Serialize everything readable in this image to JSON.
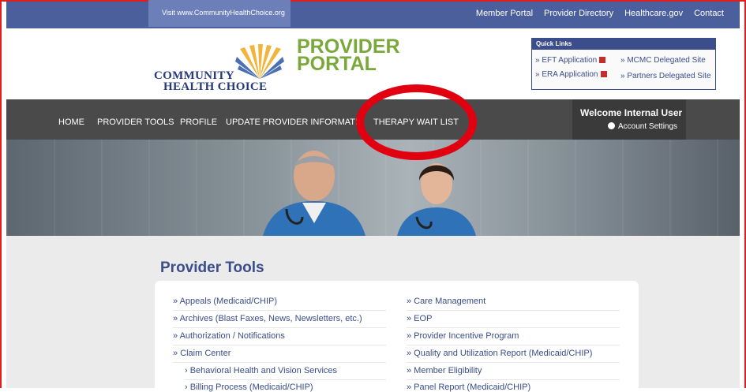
{
  "topbar": {
    "visit_link": "Visit www.CommunityHealthChoice.org",
    "nav": [
      "Member Portal",
      "Provider Directory",
      "Healthcare.gov",
      "Contact"
    ]
  },
  "logo": {
    "line1": "COMMUNITY",
    "line2": "HEALTH CHOICE"
  },
  "portal_title": {
    "line1": "PROVIDER",
    "line2": "PORTAL"
  },
  "quick_links": {
    "title": "Quick Links",
    "eft": "» EFT Application",
    "era": "» ERA Application",
    "mcmc": "» MCMC Delegated Site",
    "partners": "» Partners Delegated Site"
  },
  "main_nav": {
    "items": [
      "HOME",
      "PROVIDER TOOLS",
      "PROFILE",
      "UPDATE PROVIDER INFORMATIO",
      "THERAPY WAIT LIST"
    ],
    "welcome": "Welcome Internal User",
    "account_settings": "Account Settings"
  },
  "provider_tools": {
    "title": "Provider Tools",
    "left": [
      "» Appeals (Medicaid/CHIP)",
      "» Archives (Blast Faxes, News, Newsletters, etc.)",
      "» Authorization / Notifications",
      "» Claim Center",
      "› Behavioral Health and Vision Services",
      "› Billing Process (Medicaid/CHIP)"
    ],
    "right": [
      "» Care Management",
      "» EOP",
      "» Provider Incentive Program",
      "» Quality and Utilization Report (Medicaid/CHIP)",
      "» Member Eligibility",
      "» Panel Report (Medicaid/CHIP)"
    ]
  },
  "colors": {
    "brand_blue": "#3b4d8a",
    "brand_green": "#7aa83a",
    "annotation_red": "#e0000f"
  }
}
